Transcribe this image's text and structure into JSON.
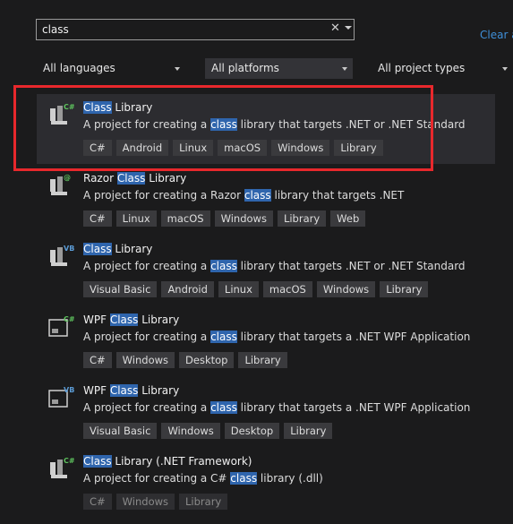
{
  "search": {
    "value": "class",
    "clear_glyph": "✕",
    "clear_link": "Clear a"
  },
  "filters": [
    {
      "label": "All languages"
    },
    {
      "label": "All platforms"
    },
    {
      "label": "All project types"
    }
  ],
  "results": [
    {
      "pre": "",
      "hl": "Class",
      "post": " Library",
      "desc_pre": "A project for creating a ",
      "desc_hl": "class",
      "desc_post": " library that targets .NET or .NET Standard",
      "icon_badge": "C#",
      "tags": [
        "C#",
        "Android",
        "Linux",
        "macOS",
        "Windows",
        "Library"
      ]
    },
    {
      "pre": "Razor ",
      "hl": "Class",
      "post": " Library",
      "desc_pre": "A project for creating a Razor ",
      "desc_hl": "class",
      "desc_post": " library that targets .NET",
      "icon_badge": "@",
      "tags": [
        "C#",
        "Linux",
        "macOS",
        "Windows",
        "Library",
        "Web"
      ]
    },
    {
      "pre": "",
      "hl": "Class",
      "post": " Library",
      "desc_pre": "A project for creating a ",
      "desc_hl": "class",
      "desc_post": " library that targets .NET or .NET Standard",
      "icon_badge": "VB",
      "tags": [
        "Visual Basic",
        "Android",
        "Linux",
        "macOS",
        "Windows",
        "Library"
      ]
    },
    {
      "pre": "WPF ",
      "hl": "Class",
      "post": " Library",
      "desc_pre": "A project for creating a ",
      "desc_hl": "class",
      "desc_post": " library that targets a .NET WPF Application",
      "icon_badge": "C#",
      "tags": [
        "C#",
        "Windows",
        "Desktop",
        "Library"
      ]
    },
    {
      "pre": "WPF ",
      "hl": "Class",
      "post": " Library",
      "desc_pre": "A project for creating a ",
      "desc_hl": "class",
      "desc_post": " library that targets a .NET WPF Application",
      "icon_badge": "VB",
      "tags": [
        "Visual Basic",
        "Windows",
        "Desktop",
        "Library"
      ]
    },
    {
      "pre": "",
      "hl": "Class",
      "post": " Library (.NET Framework)",
      "desc_pre": "A project for creating a C# ",
      "desc_hl": "class",
      "desc_post": " library (.dll)",
      "icon_badge": "C#",
      "tags": [
        "C#",
        "Windows",
        "Library"
      ]
    }
  ],
  "colors": {
    "accent": "#2f65ad",
    "highlight_box": "#e8282c",
    "csharp_badge": "#5ec35e",
    "vb_badge": "#5b9bd5"
  }
}
